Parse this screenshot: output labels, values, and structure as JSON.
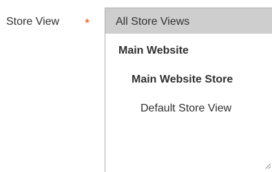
{
  "field": {
    "label": "Store View",
    "required_marker": "*",
    "required_color": "#eb5202"
  },
  "store_view_select": {
    "options": [
      {
        "label": "All Store Views",
        "level": 0,
        "bold": false,
        "selected": true
      },
      {
        "label": "Main Website",
        "level": 1,
        "bold": true,
        "selected": false
      },
      {
        "label": "Main Website Store",
        "level": 2,
        "bold": true,
        "selected": false
      },
      {
        "label": "Default Store View",
        "level": 3,
        "bold": false,
        "selected": false
      }
    ],
    "selected_background": "#cecece",
    "border_color": "#adadad"
  },
  "icons": {
    "resize_handle": "resize-grip-icon"
  }
}
